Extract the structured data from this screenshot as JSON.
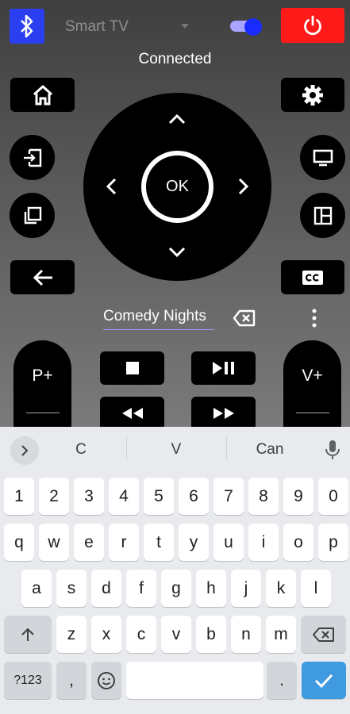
{
  "header": {
    "bluetooth_icon": "bluetooth-icon",
    "device_name": "Smart TV",
    "power_icon": "power-icon",
    "status": "Connected"
  },
  "colors": {
    "bluetooth_bg": "#2c3ff0",
    "power_bg": "#ff1a1a",
    "toggle_thumb": "#1a2bff",
    "enter_key": "#3f9ae0"
  },
  "dpad": {
    "ok_label": "OK"
  },
  "input": {
    "text": "Comedy Nights"
  },
  "channel": {
    "label": "P+"
  },
  "volume": {
    "label": "V+"
  },
  "keyboard": {
    "suggestions": [
      "C",
      "V",
      "Can"
    ],
    "row_numbers": [
      "1",
      "2",
      "3",
      "4",
      "5",
      "6",
      "7",
      "8",
      "9",
      "0"
    ],
    "row_top": [
      "q",
      "w",
      "e",
      "r",
      "t",
      "y",
      "u",
      "i",
      "o",
      "p"
    ],
    "row_mid": [
      "a",
      "s",
      "d",
      "f",
      "g",
      "h",
      "j",
      "k",
      "l"
    ],
    "row_bottom": [
      "z",
      "x",
      "c",
      "v",
      "b",
      "n",
      "m"
    ],
    "symbols_label": "?123",
    "comma": ",",
    "period": "."
  }
}
